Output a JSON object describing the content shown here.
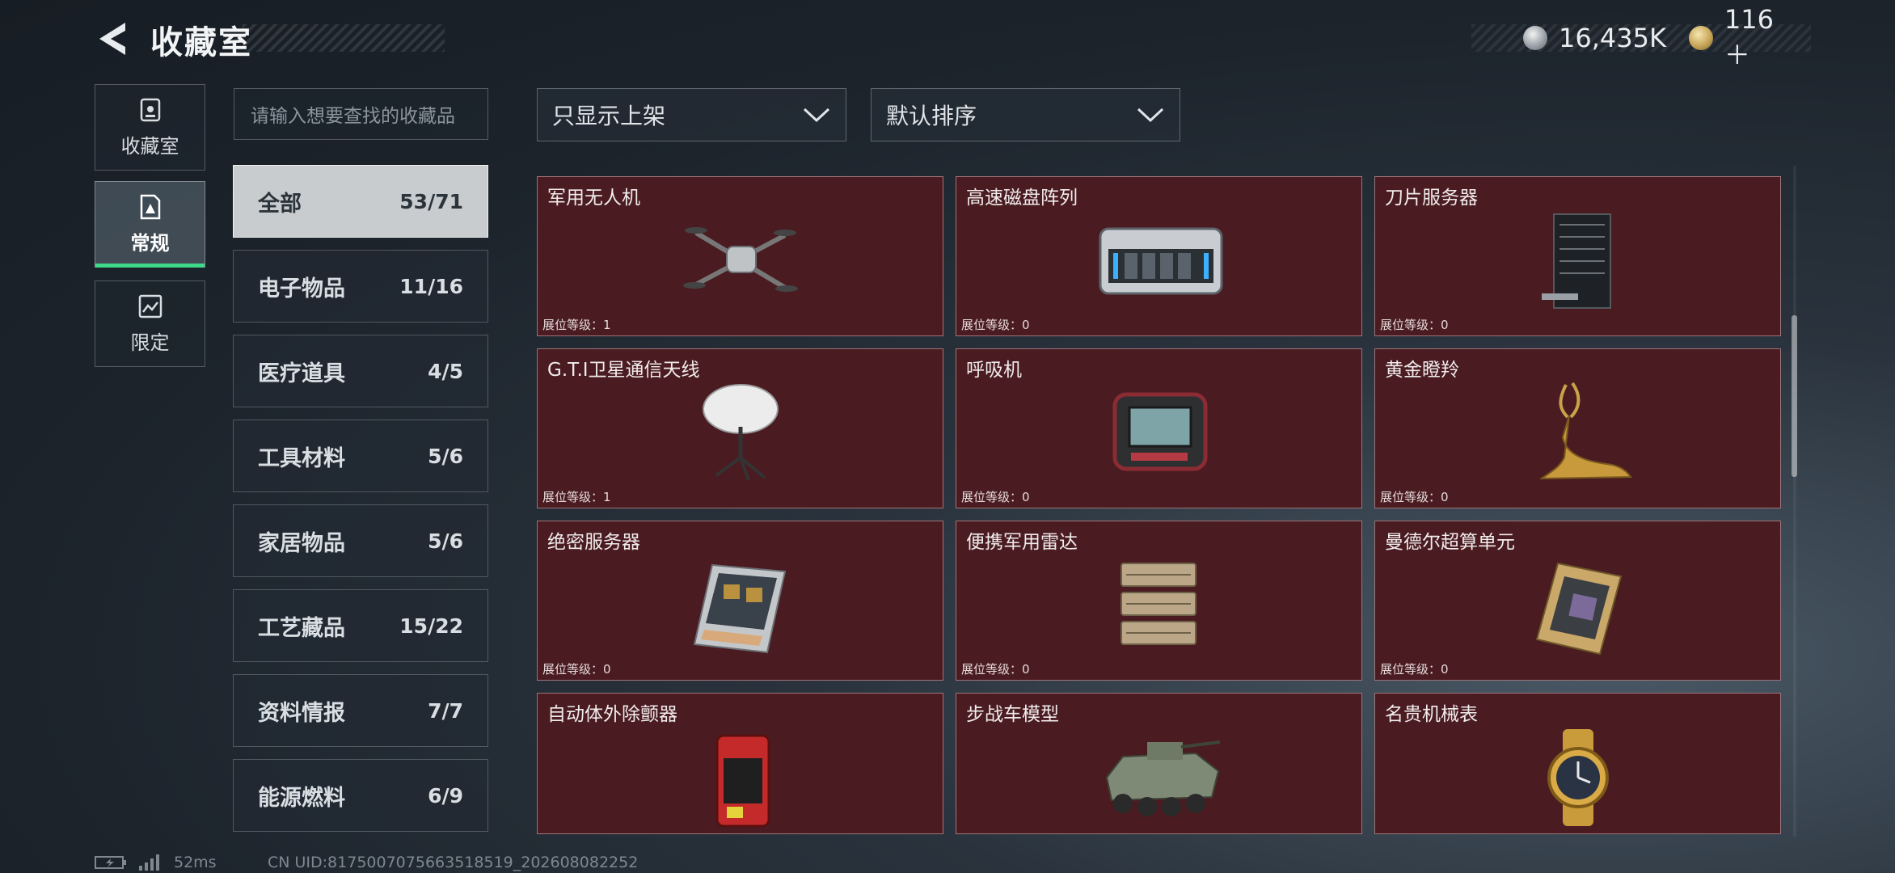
{
  "header": {
    "title": "收藏室",
    "currency": [
      {
        "icon": "silver-coin-icon",
        "value": "16,435K"
      },
      {
        "icon": "gold-coin-icon",
        "value": "116＋"
      }
    ]
  },
  "nav": [
    {
      "label": "收藏室",
      "icon": "collection-room-icon",
      "active": false
    },
    {
      "label": "常规",
      "icon": "regular-icon",
      "active": true
    },
    {
      "label": "限定",
      "icon": "limited-icon",
      "active": false
    }
  ],
  "search": {
    "placeholder": "请输入想要查找的收藏品"
  },
  "categories": [
    {
      "name": "全部",
      "count": "53/71"
    },
    {
      "name": "电子物品",
      "count": "11/16"
    },
    {
      "name": "医疗道具",
      "count": "4/5"
    },
    {
      "name": "工具材料",
      "count": "5/6"
    },
    {
      "name": "家居物品",
      "count": "5/6"
    },
    {
      "name": "工艺藏品",
      "count": "15/22"
    },
    {
      "name": "资料情报",
      "count": "7/7"
    },
    {
      "name": "能源燃料",
      "count": "6/9"
    }
  ],
  "filters": {
    "show": "只显示上架",
    "sort": "默认排序"
  },
  "level_label": "展位等级：",
  "items": [
    {
      "name": "军用无人机",
      "level": "1"
    },
    {
      "name": "高速磁盘阵列",
      "level": "0"
    },
    {
      "name": "刀片服务器",
      "level": "0"
    },
    {
      "name": "G.T.I卫星通信天线",
      "level": "1"
    },
    {
      "name": "呼吸机",
      "level": "0"
    },
    {
      "name": "黄金瞪羚",
      "level": "0"
    },
    {
      "name": "绝密服务器",
      "level": "0"
    },
    {
      "name": "便携军用雷达",
      "level": "0"
    },
    {
      "name": "曼德尔超算单元",
      "level": "0"
    },
    {
      "name": "自动体外除颤器",
      "level": ""
    },
    {
      "name": "步战车模型",
      "level": ""
    },
    {
      "name": "名贵机械表",
      "level": ""
    }
  ],
  "footer": {
    "ping": "52ms",
    "uid": "CN UID:8175007075663518519_202608082252"
  }
}
